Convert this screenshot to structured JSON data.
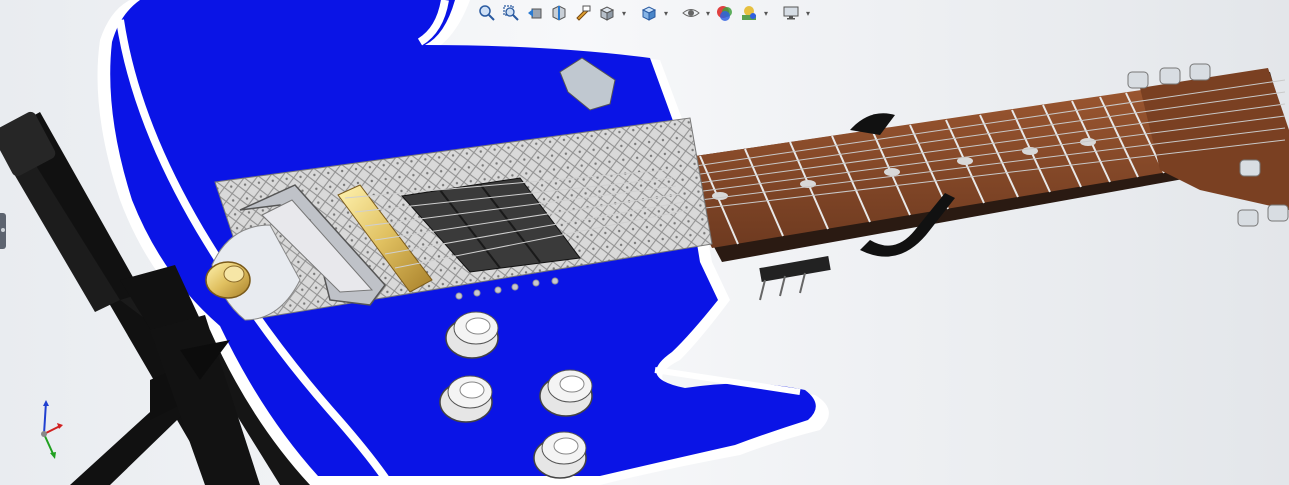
{
  "window": {
    "title": ""
  },
  "hud_toolbar": {
    "buttons": [
      {
        "id": "zoom-to-fit",
        "icon": "zoom-fit-icon",
        "has_dropdown": false
      },
      {
        "id": "zoom-to-area",
        "icon": "zoom-area-icon",
        "has_dropdown": false
      },
      {
        "id": "previous-view",
        "icon": "previous-view-icon",
        "has_dropdown": false
      },
      {
        "id": "section-view",
        "icon": "section-view-icon",
        "has_dropdown": false
      },
      {
        "id": "dynamic-annotation",
        "icon": "annotation-view-icon",
        "has_dropdown": false
      },
      {
        "id": "view-orientation",
        "icon": "view-orientation-icon",
        "has_dropdown": true
      },
      {
        "id": "display-style",
        "icon": "display-style-cube-icon",
        "has_dropdown": true
      },
      {
        "id": "hide-show-items",
        "icon": "eye-icon",
        "has_dropdown": true
      },
      {
        "id": "edit-appearance",
        "icon": "appearance-sphere-icon",
        "has_dropdown": false
      },
      {
        "id": "apply-scene",
        "icon": "scene-icon",
        "has_dropdown": true
      },
      {
        "id": "view-settings",
        "icon": "monitor-icon",
        "has_dropdown": true
      }
    ]
  },
  "model": {
    "body_color": "#0a14e6",
    "binding_color": "#ffffff",
    "pickguard_pattern": "mesh-diamond",
    "neck_color": "#8a4b2b",
    "fret_color": "#e8e8e8",
    "hardware_gold": "#e0c060",
    "pickup_color": "#3a3a3a",
    "stand_color": "#111111"
  },
  "triad": {
    "x_color": "#d02020",
    "y_color": "#20a020",
    "z_color": "#2040d0"
  },
  "colors": {
    "background_left": "#e9ecf0",
    "background_right": "#e3e6ea"
  }
}
